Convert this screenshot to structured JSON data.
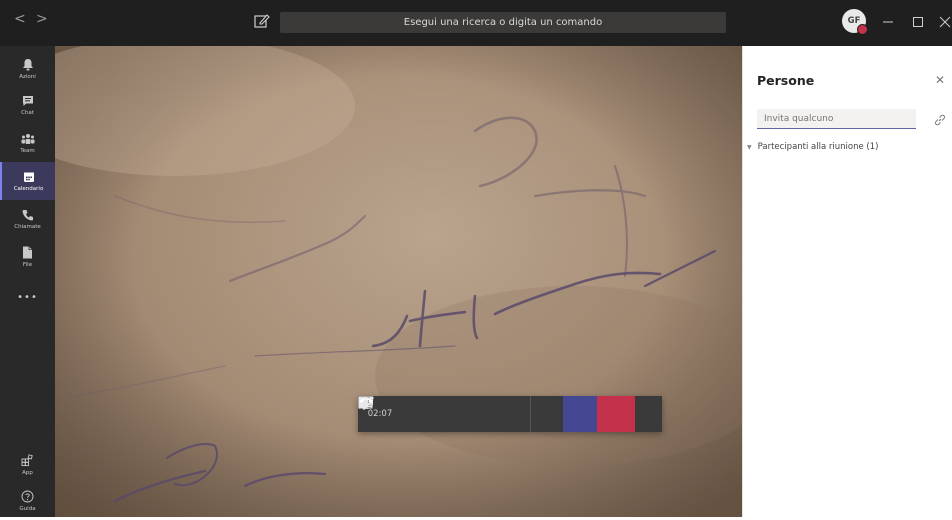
{
  "titlebar": {
    "search_text": "Esegui una ricerca o digita un comando",
    "avatar_initials": "GF",
    "back_glyph": "<",
    "forward_glyph": ">"
  },
  "rail": {
    "items": [
      {
        "label": "Azioni",
        "icon": "bell-icon"
      },
      {
        "label": "Chat",
        "icon": "chat-icon"
      },
      {
        "label": "Team",
        "icon": "teams-icon"
      },
      {
        "label": "Calendario",
        "icon": "calendar-icon"
      },
      {
        "label": "Chiamate",
        "icon": "phone-icon"
      },
      {
        "label": "File",
        "icon": "file-icon"
      },
      {
        "label": "•••",
        "icon": "more-icon"
      },
      {
        "label": "App",
        "icon": "apps-icon"
      },
      {
        "label": "Guida",
        "icon": "help-icon"
      }
    ],
    "active": "Calendario"
  },
  "call": {
    "timer": "02:07"
  },
  "panel": {
    "title": "Persone",
    "invite_placeholder": "Invita qualcuno",
    "participants_label": "Partecipanti alla riunione (1)"
  },
  "colors": {
    "accent": "#6264a7",
    "hangup": "#c4314b",
    "titlebar": "#1f1f1f",
    "rail": "#292929"
  }
}
